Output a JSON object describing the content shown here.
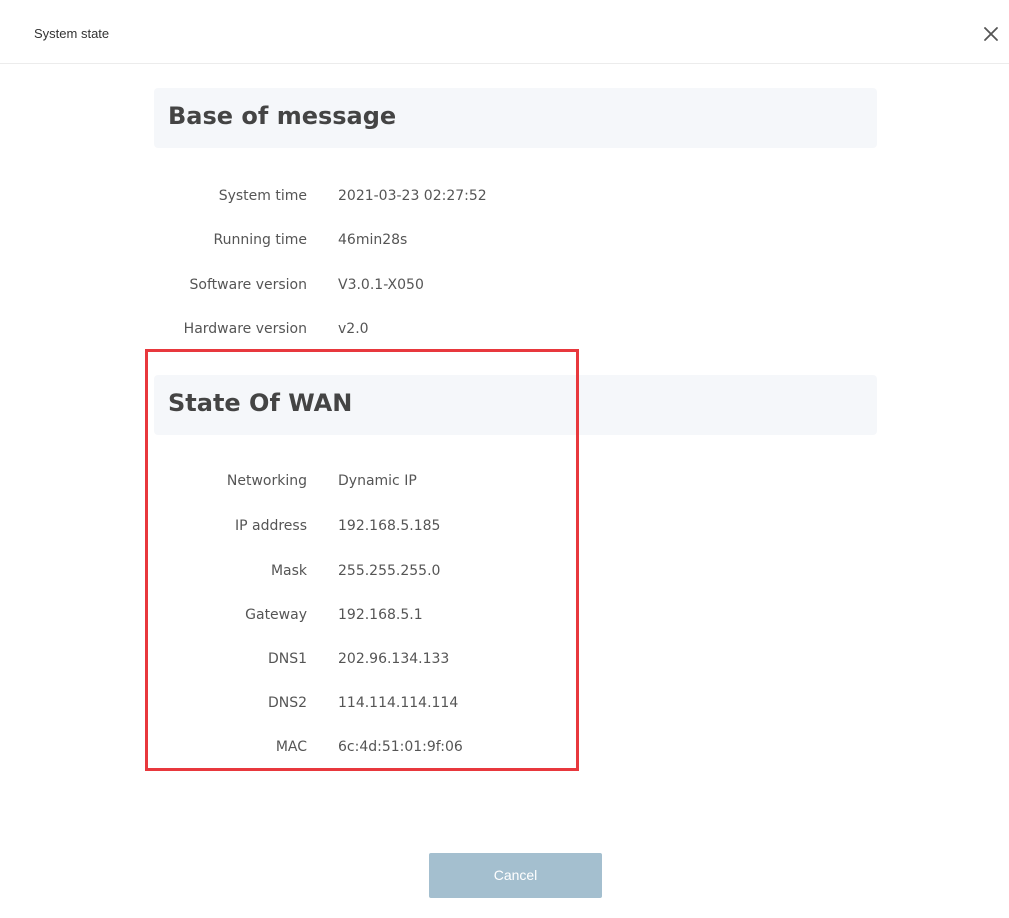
{
  "dialog": {
    "title": "System state",
    "close_icon": "close-icon"
  },
  "base_section": {
    "title": "Base of message",
    "rows": [
      {
        "label": "System time",
        "value": "2021-03-23 02:27:52"
      },
      {
        "label": "Running time",
        "value": "46min28s"
      },
      {
        "label": "Software version",
        "value": "V3.0.1-X050"
      },
      {
        "label": "Hardware version",
        "value": "v2.0"
      }
    ]
  },
  "wan_section": {
    "title": "State Of WAN",
    "rows": [
      {
        "label": "Networking",
        "value": "Dynamic IP"
      },
      {
        "label": "IP address",
        "value": "192.168.5.185"
      },
      {
        "label": "Mask",
        "value": "255.255.255.0"
      },
      {
        "label": "Gateway",
        "value": "192.168.5.1"
      },
      {
        "label": "DNS1",
        "value": "202.96.134.133"
      },
      {
        "label": "DNS2",
        "value": "114.114.114.114"
      },
      {
        "label": "MAC",
        "value": "6c:4d:51:01:9f:06"
      }
    ]
  },
  "footer": {
    "cancel_label": "Cancel"
  },
  "colors": {
    "highlight_border": "#e8383d",
    "section_bg": "#f5f7fa",
    "cancel_bg": "#a4bfcf"
  }
}
